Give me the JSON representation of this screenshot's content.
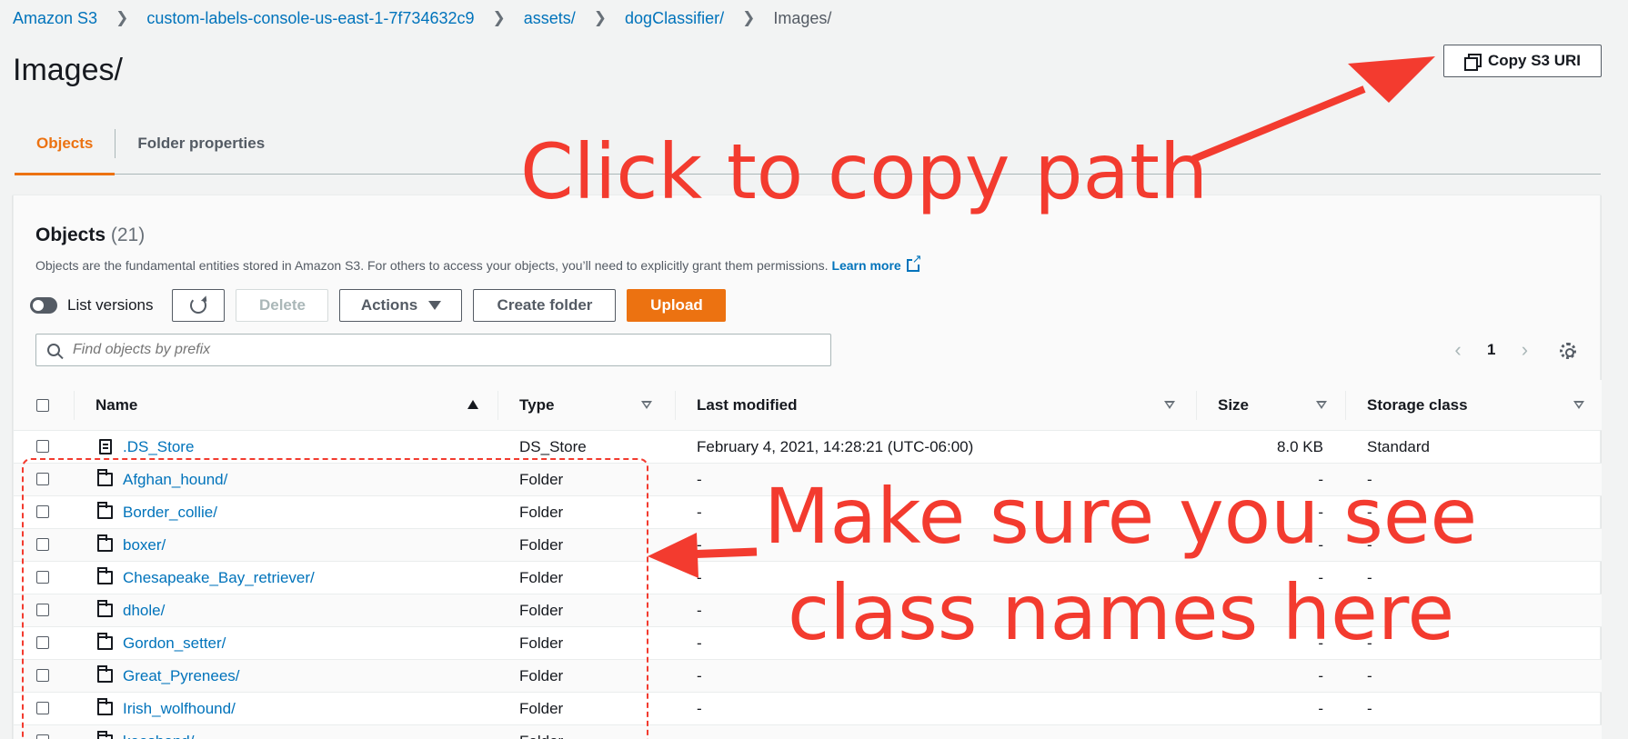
{
  "breadcrumb": [
    {
      "label": "Amazon S3"
    },
    {
      "label": "custom-labels-console-us-east-1-7f734632c9"
    },
    {
      "label": "assets/"
    },
    {
      "label": "dogClassifier/"
    },
    {
      "label": "Images/"
    }
  ],
  "page": {
    "title": "Images/",
    "copy_button": "Copy S3 URI"
  },
  "tabs": [
    {
      "label": "Objects",
      "active": true
    },
    {
      "label": "Folder properties",
      "active": false
    }
  ],
  "objects_panel": {
    "title": "Objects",
    "count": "(21)",
    "description": "Objects are the fundamental entities stored in Amazon S3. For others to access your objects, you’ll need to explicitly grant them permissions.",
    "learn_more": "Learn more",
    "toolbar": {
      "list_versions": "List versions",
      "delete": "Delete",
      "actions": "Actions",
      "create_folder": "Create folder",
      "upload": "Upload"
    },
    "search_placeholder": "Find objects by prefix",
    "page_number": "1"
  },
  "table": {
    "columns": {
      "name": "Name",
      "type": "Type",
      "last_modified": "Last modified",
      "size": "Size",
      "storage_class": "Storage class"
    },
    "rows": [
      {
        "name": ".DS_Store",
        "kind": "file",
        "type": "DS_Store",
        "last_modified": "February 4, 2021, 14:28:21 (UTC-06:00)",
        "size": "8.0 KB",
        "storage_class": "Standard"
      },
      {
        "name": "Afghan_hound/",
        "kind": "folder",
        "type": "Folder",
        "last_modified": "-",
        "size": "-",
        "storage_class": "-"
      },
      {
        "name": "Border_collie/",
        "kind": "folder",
        "type": "Folder",
        "last_modified": "-",
        "size": "-",
        "storage_class": "-"
      },
      {
        "name": "boxer/",
        "kind": "folder",
        "type": "Folder",
        "last_modified": "-",
        "size": "-",
        "storage_class": "-"
      },
      {
        "name": "Chesapeake_Bay_retriever/",
        "kind": "folder",
        "type": "Folder",
        "last_modified": "-",
        "size": "-",
        "storage_class": "-"
      },
      {
        "name": "dhole/",
        "kind": "folder",
        "type": "Folder",
        "last_modified": "-",
        "size": "-",
        "storage_class": "-"
      },
      {
        "name": "Gordon_setter/",
        "kind": "folder",
        "type": "Folder",
        "last_modified": "-",
        "size": "-",
        "storage_class": "-"
      },
      {
        "name": "Great_Pyrenees/",
        "kind": "folder",
        "type": "Folder",
        "last_modified": "-",
        "size": "-",
        "storage_class": "-"
      },
      {
        "name": "Irish_wolfhound/",
        "kind": "folder",
        "type": "Folder",
        "last_modified": "-",
        "size": "-",
        "storage_class": "-"
      },
      {
        "name": "keeshond/",
        "kind": "folder",
        "type": "Folder",
        "last_modified": "-",
        "size": "-",
        "storage_class": "-"
      }
    ]
  },
  "annotations": {
    "copy_hint": "Click to copy path",
    "class_hint_line1": "Make sure you see",
    "class_hint_line2": "class names here",
    "color": "#f33b2f"
  }
}
